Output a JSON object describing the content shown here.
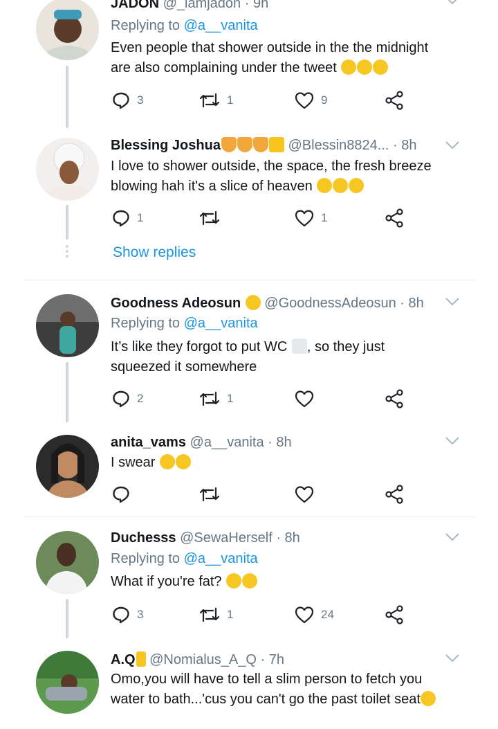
{
  "tweets": [
    {
      "name": "JADON",
      "handle": "@_iamjadon",
      "time": "· 9h",
      "reply_prefix": "Replying to ",
      "reply_to": "@a__vanita",
      "text_line1": "Even people that shower outside in the the midnight",
      "text_line2": "are also complaining under the tweet",
      "replies": "3",
      "retweets": "1",
      "likes": "9"
    },
    {
      "name": "Blessing Joshua",
      "handle": "@Blessin8824...",
      "time": "· 8h",
      "text_line1": "I love to shower outside, the space, the fresh breeze",
      "text_line2": "blowing  hah it's a slice of heaven",
      "replies": "1",
      "retweets": "",
      "likes": "1",
      "show_replies": "Show replies"
    },
    {
      "name": "Goodness Adeosun",
      "handle": "@GoodnessAdeosun",
      "time": "· 8h",
      "reply_prefix": "Replying to ",
      "reply_to": "@a__vanita",
      "text_line1": "It’s like they forgot to put WC",
      "text_line1b": ", so they just",
      "text_line2": "squeezed it somewhere",
      "replies": "2",
      "retweets": "1",
      "likes": ""
    },
    {
      "name": "anita_vams",
      "handle": "@a__vanita",
      "time": "· 8h",
      "text_line1": "I swear",
      "replies": "",
      "retweets": "",
      "likes": ""
    },
    {
      "name": "Duchesss",
      "handle": "@SewaHerself",
      "time": "· 8h",
      "reply_prefix": "Replying to ",
      "reply_to": "@a__vanita",
      "text_line1": "What if you're fat?",
      "replies": "3",
      "retweets": "1",
      "likes": "24"
    },
    {
      "name": "A.Q",
      "handle": "@Nomialus_A_Q",
      "time": "· 7h",
      "text_line1": "Omo,you will have to tell a slim person to fetch you",
      "text_line2": "water to bath...'cus you can't go the past toilet seat"
    }
  ],
  "icons": {
    "reply": "reply-icon",
    "retweet": "retweet-icon",
    "like": "heart-icon",
    "share": "share-icon",
    "caret": "chevron-down-icon"
  },
  "colors": {
    "link": "#1b95e0",
    "muted": "#657786",
    "text": "#14171a"
  }
}
